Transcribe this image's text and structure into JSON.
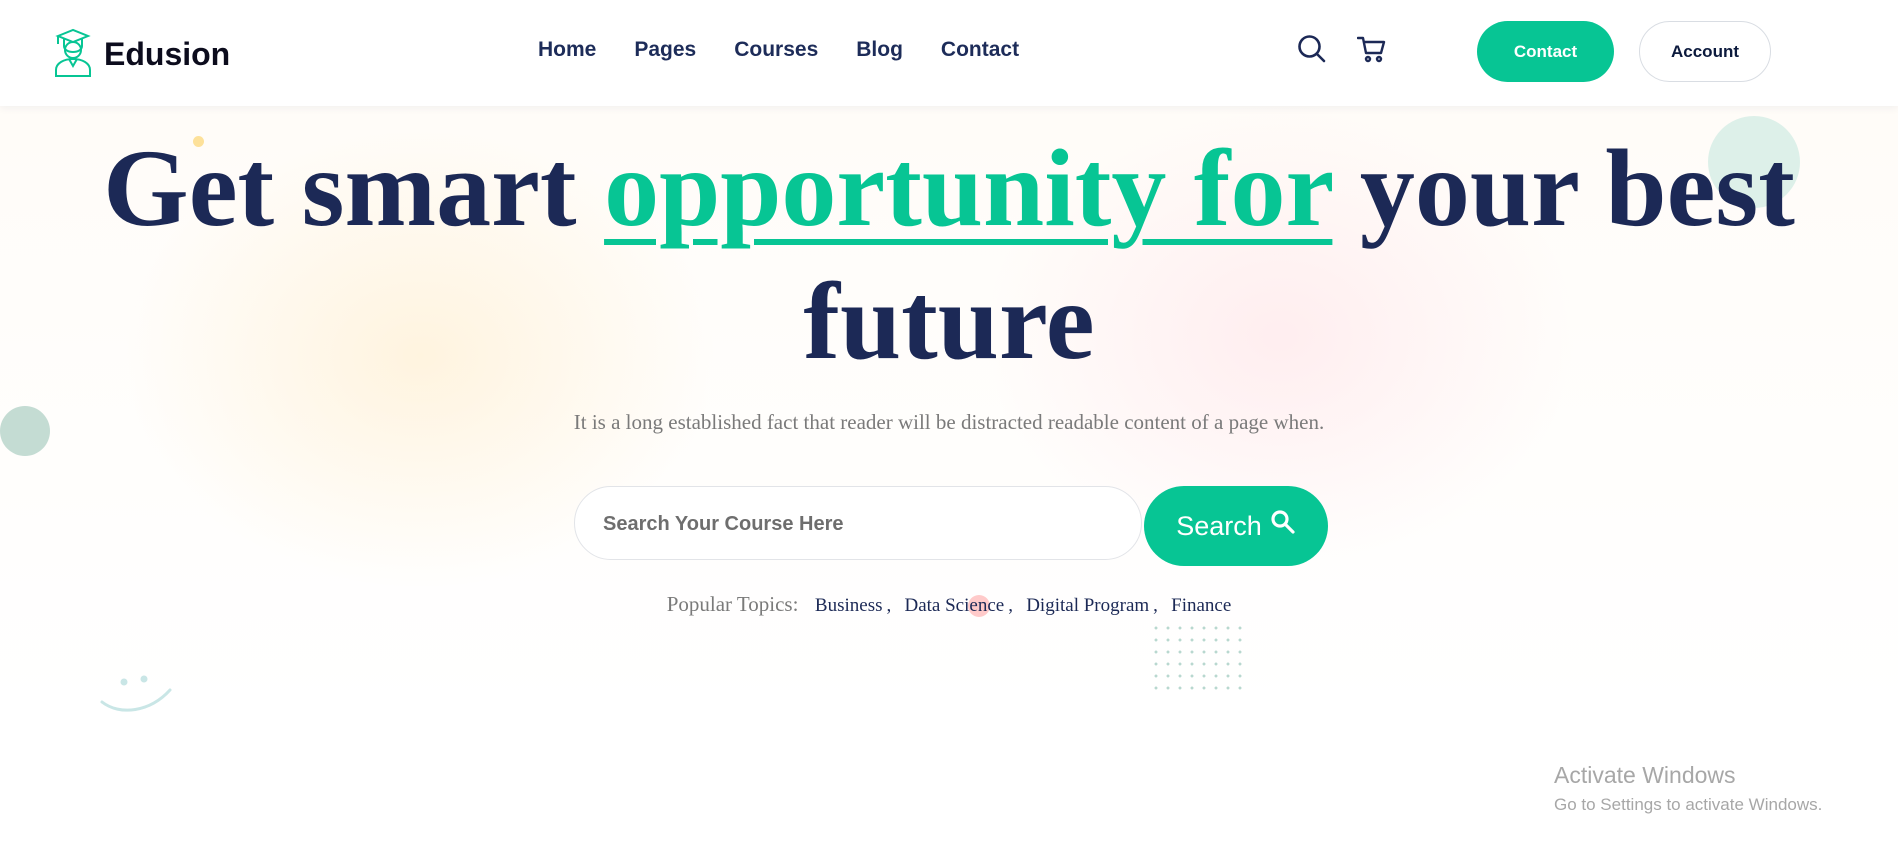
{
  "brand": {
    "name": "Edusion",
    "logo_icon": "graduate-student-icon",
    "accent": "#07c594",
    "navy": "#1c2956"
  },
  "nav": {
    "items": [
      "Home",
      "Pages",
      "Courses",
      "Blog",
      "Contact"
    ]
  },
  "header_actions": {
    "search_icon": "search-icon",
    "cart_icon": "cart-icon",
    "contact_label": "Contact",
    "account_label": "Account"
  },
  "hero": {
    "headline_before": "Get smart ",
    "headline_highlight": "opportunity for",
    "headline_after": " your best future",
    "subtitle": "It is a long established fact that reader will be distracted readable content of a page when.",
    "search_placeholder": "Search Your Course Here",
    "search_button_label": "Search",
    "popular_label": "Popular Topics:",
    "topics": [
      "Business",
      "Data Science",
      "Digital Program",
      "Finance"
    ],
    "topic_separator": ","
  },
  "os_overlay": {
    "title": "Activate Windows",
    "subtitle": "Go to Settings to activate Windows."
  }
}
